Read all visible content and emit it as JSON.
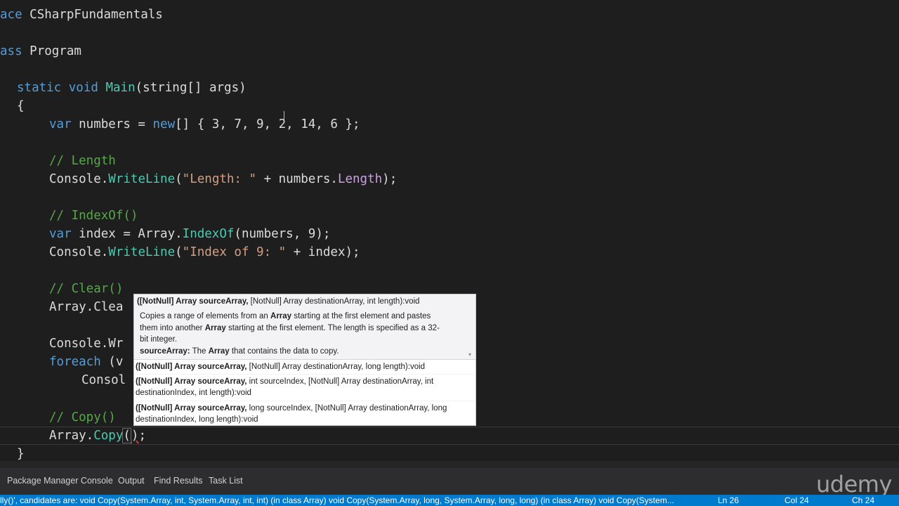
{
  "editor": {
    "lines": {
      "l1_kw": "ace",
      "l1_name": "CSharpFundamentals",
      "l2_kw": "ass",
      "l2_name": "Program",
      "l3_static": "static",
      "l3_void": "void",
      "l3_main": "Main",
      "l3_params": "(string[] args)",
      "l4_brace": "{",
      "l5_var": "var",
      "l5_rest": " numbers = ",
      "l5_new": "new",
      "l5_tail": "[] { 3, 7, 9, 2, 14, 6 };",
      "l6_comment": "// Length",
      "l7_console": "Console.",
      "l7_wl": "WriteLine",
      "l7_open": "(",
      "l7_str": "\"Length: \"",
      "l7_mid": " + numbers.",
      "l7_len": "Length",
      "l7_end": ");",
      "l8_comment": "// IndexOf()",
      "l9_var": "var",
      "l9_mid": " index = Array.",
      "l9_method": "IndexOf",
      "l9_end": "(numbers, 9);",
      "l10_console": "Console.",
      "l10_wl": "WriteLine",
      "l10_open": "(",
      "l10_str": "\"Index of 9: \"",
      "l10_end": " + index);",
      "l11_comment": "// Clear()",
      "l12_text": "Array.Clea",
      "l13_text": "Console.Wr",
      "l14_kw": "foreach",
      "l14_text": " (v",
      "l15_text": "Consol",
      "l16_comment": "// Copy()",
      "l17_array": "Array.",
      "l17_method": "Copy",
      "l17_open": "(",
      "l17_close": ")",
      "l17_end": ";",
      "l18_brace": "}"
    }
  },
  "tooltip": {
    "sig_bold": "([NotNull] Array sourceArray,",
    "sig_rest": " [NotNull] Array destinationArray, int length):void",
    "desc_1a": "Copies a range of elements from an ",
    "desc_1b": "Array",
    "desc_1c": " starting at the first element and pastes",
    "desc_2a": "them into another ",
    "desc_2b": "Array",
    "desc_2c": " starting at the first element. The length is specified as a 32-",
    "desc_3": "bit integer.",
    "param_name": "sourceArray:",
    "param_a": " The ",
    "param_b": "Array",
    "param_c": " that contains the data to copy.",
    "overloads": [
      {
        "bold": "([NotNull] Array sourceArray,",
        "rest": " [NotNull] Array destinationArray, long length):void"
      },
      {
        "bold": "([NotNull] Array sourceArray,",
        "rest": " int sourceIndex, [NotNull] Array destinationArray, int",
        "rest2": "destinationIndex, int length):void"
      },
      {
        "bold": "([NotNull] Array sourceArray,",
        "rest": " long sourceIndex, [NotNull] Array destinationArray, long",
        "rest2": "destinationIndex, long length):void"
      }
    ]
  },
  "bottom_tabs": [
    "Package Manager Console",
    "Output",
    "Find Results",
    "Task List"
  ],
  "status_bar": {
    "message": "lly()', candidates are:   void Copy(System.Array, int, System.Array, int, int) (in class Array)   void Copy(System.Array, long, System.Array, long, long) (in class Array)   void Copy(System...",
    "ln": "Ln 26",
    "col": "Col 24",
    "ch": "Ch 24"
  },
  "watermark": "udemy",
  "colors": {
    "keyword": "#569cd6",
    "comment": "#57a64a",
    "string": "#d69d85",
    "method": "#4ec9b0",
    "status": "#007acc"
  }
}
